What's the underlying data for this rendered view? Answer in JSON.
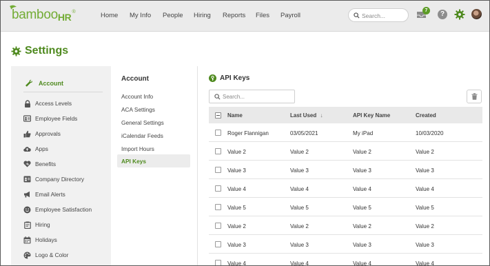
{
  "app": {
    "logo_text": "bamboo",
    "logo_suffix": "HR",
    "logo_reg": "®"
  },
  "nav": {
    "items": [
      "Home",
      "My Info",
      "People",
      "Hiring",
      "Reports",
      "Files",
      "Payroll"
    ]
  },
  "top_search": {
    "placeholder": "Search..."
  },
  "inbox": {
    "count": "7"
  },
  "help": {
    "label": "?"
  },
  "page": {
    "title": "Settings"
  },
  "sidebar": {
    "account_label": "Account",
    "items": [
      {
        "label": "Access Levels",
        "icon": "lock-icon"
      },
      {
        "label": "Employee Fields",
        "icon": "employee-fields-icon"
      },
      {
        "label": "Approvals",
        "icon": "thumbs-up-icon"
      },
      {
        "label": "Apps",
        "icon": "cloud-icon"
      },
      {
        "label": "Benefits",
        "icon": "heart-icon"
      },
      {
        "label": "Company Directory",
        "icon": "directory-card-icon"
      },
      {
        "label": "Email Alerts",
        "icon": "megaphone-icon"
      },
      {
        "label": "Employee Satisfaction",
        "icon": "smiley-icon"
      },
      {
        "label": "Hiring",
        "icon": "clipboard-icon"
      },
      {
        "label": "Holidays",
        "icon": "calendar-icon"
      },
      {
        "label": "Logo & Color",
        "icon": "palette-icon"
      }
    ]
  },
  "subnav": {
    "heading": "Account",
    "links": [
      "Account Info",
      "ACA Settings",
      "General Settings",
      "iCalendar Feeds",
      "Import Hours",
      "API Keys"
    ],
    "active": "API Keys"
  },
  "main": {
    "title": "API Keys",
    "search_placeholder": "Search...",
    "columns": {
      "name": "Name",
      "last_used": "Last Used",
      "sort_icon": "↓",
      "api_key_name": "API Key Name",
      "created": "Created"
    },
    "rows": [
      {
        "name": "Roger Flannigan",
        "last_used": "03/05/2021",
        "api_key_name": "My iPad",
        "created": "10/03/2020"
      },
      {
        "name": "Value 2",
        "last_used": "Value 2",
        "api_key_name": "Value 2",
        "created": "Value 2"
      },
      {
        "name": "Value 3",
        "last_used": "Value 3",
        "api_key_name": "Value 3",
        "created": "Value 3"
      },
      {
        "name": "Value 4",
        "last_used": "Value 4",
        "api_key_name": "Value 4",
        "created": "Value 4"
      },
      {
        "name": "Value 5",
        "last_used": "Value 5",
        "api_key_name": "Value 5",
        "created": "Value 5"
      },
      {
        "name": "Value 2",
        "last_used": "Value 2",
        "api_key_name": "Value 2",
        "created": "Value 2"
      },
      {
        "name": "Value 3",
        "last_used": "Value 3",
        "api_key_name": "Value 3",
        "created": "Value 3"
      },
      {
        "name": "Value 4",
        "last_used": "Value 4",
        "api_key_name": "Value 4",
        "created": "Value 4"
      }
    ]
  },
  "colors": {
    "brand_green": "#4f8a1f",
    "logo_green": "#73ac35",
    "topbar_bg": "#ebebeb",
    "sidebar_bg": "#f1f1f1",
    "table_header_bg": "#e9e9e9"
  }
}
